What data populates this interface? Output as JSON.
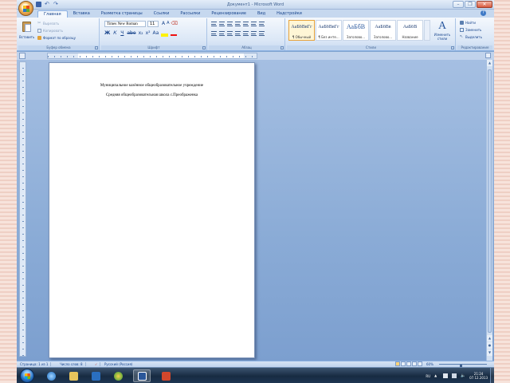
{
  "window": {
    "title": "Документ1 - Microsoft Word"
  },
  "tabs": [
    "Главная",
    "Вставка",
    "Разметка страницы",
    "Ссылки",
    "Рассылки",
    "Рецензирование",
    "Вид",
    "Надстройки"
  ],
  "clipboard": {
    "paste_label": "Вставить",
    "cut_label": "Вырезать",
    "copy_label": "Копировать",
    "format_painter_label": "Формат по образцу",
    "group_label": "Буфер обмена"
  },
  "font": {
    "name": "Times New Roman",
    "size": "11",
    "group_label": "Шрифт"
  },
  "paragraph": {
    "group_label": "Абзац"
  },
  "styles": {
    "items": [
      {
        "sample": "АаБбВвГг",
        "name": "¶ Обычный"
      },
      {
        "sample": "АаБбВвГг",
        "name": "¶ Без инте..."
      },
      {
        "sample": "АаБбВ",
        "name": "Заголово..."
      },
      {
        "sample": "АаБбВв",
        "name": "Заголово..."
      },
      {
        "sample": "АаБбВ",
        "name": "Название"
      },
      {
        "sample": "АаВ",
        "name": ""
      }
    ],
    "change_label": "Изменить стили",
    "group_label": "Стили"
  },
  "editing": {
    "find_label": "Найти",
    "replace_label": "Заменить",
    "select_label": "Выделить",
    "group_label": "Редактирование"
  },
  "document": {
    "line1": "Муниципальное казённое общеобразовательное учреждение",
    "line2": "Средняя общеобразовательная школа с.Преображенка"
  },
  "status": {
    "page": "Страница: 1 из 1",
    "words": "Число слов: 8",
    "language": "Русский (Россия)",
    "zoom": "60%",
    "zoom_fraction": 0.45
  },
  "tray": {
    "lang": "RU",
    "time": "21:24",
    "date": "07.12.2013"
  }
}
